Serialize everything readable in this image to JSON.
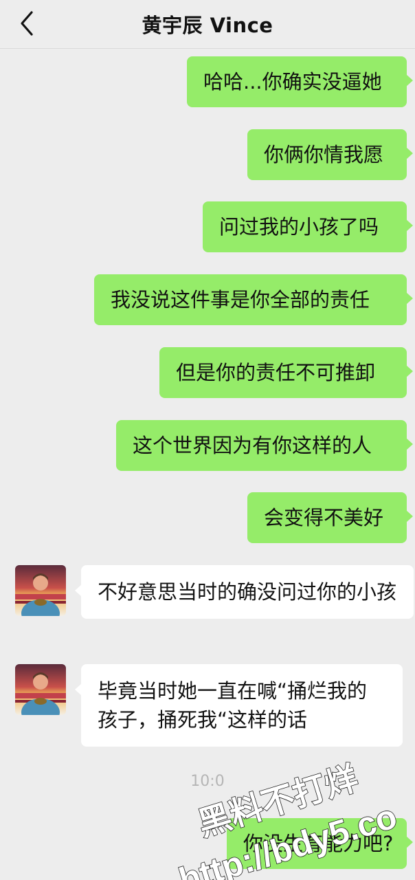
{
  "header": {
    "title": "黄宇辰 Vince"
  },
  "messages": [
    {
      "from": "me",
      "text": "哈哈...你确实没逼她"
    },
    {
      "from": "me",
      "text": "你俩你情我愿"
    },
    {
      "from": "me",
      "text": "问过我的小孩了吗"
    },
    {
      "from": "me",
      "text": "我没说这件事是你全部的责任"
    },
    {
      "from": "me",
      "text": "但是你的责任不可推卸"
    },
    {
      "from": "me",
      "text": "这个世界因为有你这样的人"
    },
    {
      "from": "me",
      "text": "会变得不美好"
    },
    {
      "from": "them",
      "text": "不好意思当时的确没问过你的小孩"
    },
    {
      "from": "them",
      "text": "毕竟当时她一直在喊“捅烂我的孩子，捅死我“这样的话"
    },
    {
      "from": "me",
      "text": "你没生育能力吧?"
    }
  ],
  "timestamp": "10:0",
  "watermark": {
    "line1": "黑料不打烊",
    "line2": "http://bdy5.co"
  },
  "colors": {
    "my_bubble": "#95ec69",
    "their_bubble": "#ffffff",
    "background": "#ededed"
  }
}
